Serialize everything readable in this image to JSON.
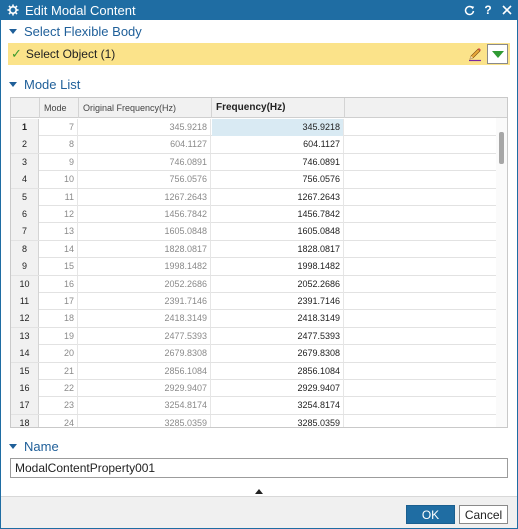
{
  "window": {
    "title": "Edit Modal Content",
    "icons": [
      "gear-icon",
      "reset-icon",
      "help-icon",
      "close-icon"
    ],
    "accent_color": "#1f6da3"
  },
  "select_section": {
    "title": "Select Flexible Body",
    "selection_label": "Select Object (1)",
    "highlight_color": "#fbe38a"
  },
  "mode_list": {
    "title": "Mode List",
    "columns": [
      "",
      "Mode",
      "Original Frequency(Hz)",
      "Frequency(Hz)"
    ],
    "rows": [
      {
        "index": "1",
        "mode": "7",
        "original": "345.9218",
        "frequency": "345.9218"
      },
      {
        "index": "2",
        "mode": "8",
        "original": "604.1127",
        "frequency": "604.1127"
      },
      {
        "index": "3",
        "mode": "9",
        "original": "746.0891",
        "frequency": "746.0891"
      },
      {
        "index": "4",
        "mode": "10",
        "original": "756.0576",
        "frequency": "756.0576"
      },
      {
        "index": "5",
        "mode": "11",
        "original": "1267.2643",
        "frequency": "1267.2643"
      },
      {
        "index": "6",
        "mode": "12",
        "original": "1456.7842",
        "frequency": "1456.7842"
      },
      {
        "index": "7",
        "mode": "13",
        "original": "1605.0848",
        "frequency": "1605.0848"
      },
      {
        "index": "8",
        "mode": "14",
        "original": "1828.0817",
        "frequency": "1828.0817"
      },
      {
        "index": "9",
        "mode": "15",
        "original": "1998.1482",
        "frequency": "1998.1482"
      },
      {
        "index": "10",
        "mode": "16",
        "original": "2052.2686",
        "frequency": "2052.2686"
      },
      {
        "index": "11",
        "mode": "17",
        "original": "2391.7146",
        "frequency": "2391.7146"
      },
      {
        "index": "12",
        "mode": "18",
        "original": "2418.3149",
        "frequency": "2418.3149"
      },
      {
        "index": "13",
        "mode": "19",
        "original": "2477.5393",
        "frequency": "2477.5393"
      },
      {
        "index": "14",
        "mode": "20",
        "original": "2679.8308",
        "frequency": "2679.8308"
      },
      {
        "index": "15",
        "mode": "21",
        "original": "2856.1084",
        "frequency": "2856.1084"
      },
      {
        "index": "16",
        "mode": "22",
        "original": "2929.9407",
        "frequency": "2929.9407"
      },
      {
        "index": "17",
        "mode": "23",
        "original": "3254.8174",
        "frequency": "3254.8174"
      },
      {
        "index": "18",
        "mode": "24",
        "original": "3285.0359",
        "frequency": "3285.0359"
      }
    ]
  },
  "name_section": {
    "title": "Name",
    "value": "ModalContentProperty001"
  },
  "footer": {
    "ok_label": "OK",
    "cancel_label": "Cancel"
  }
}
